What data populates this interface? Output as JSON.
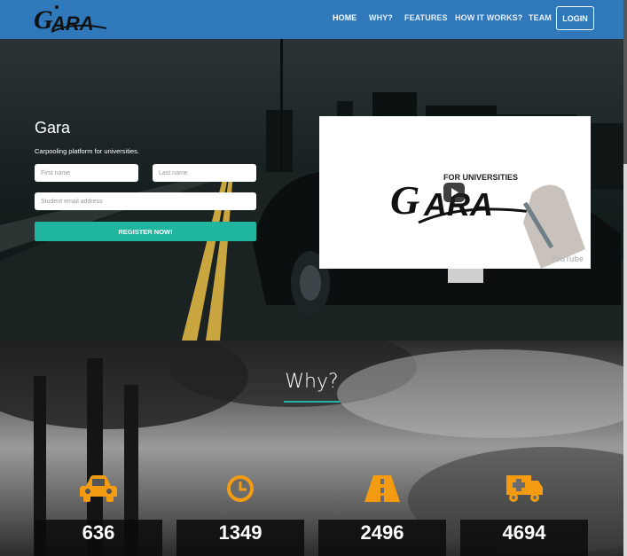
{
  "navbar": {
    "logo_text": "GARA",
    "links": [
      "HOME",
      "WHY?",
      "FEATURES",
      "HOW IT WORKS?",
      "TEAM"
    ],
    "login_label": "LOGIN",
    "color": "#2f78b9"
  },
  "hero": {
    "brand": "Gara",
    "tagline": "Carpooling platform for universities.",
    "first_name_placeholder": "First name",
    "last_name_placeholder": "Last name",
    "email_placeholder": "Student email address",
    "register_label": "REGISTER NOW!",
    "video": {
      "caption": "FOR UNIVERSITIES",
      "logo_text": "GARA",
      "watermark": "YouTube"
    }
  },
  "why": {
    "title": "Why?",
    "stats": [
      {
        "icon": "car-icon",
        "value": "636"
      },
      {
        "icon": "clock-icon",
        "value": "1349"
      },
      {
        "icon": "road-icon",
        "value": "2496"
      },
      {
        "icon": "ambulance-icon",
        "value": "4694"
      }
    ]
  },
  "colors": {
    "accent": "#1fb59e",
    "stat_icon": "#f39c12"
  }
}
